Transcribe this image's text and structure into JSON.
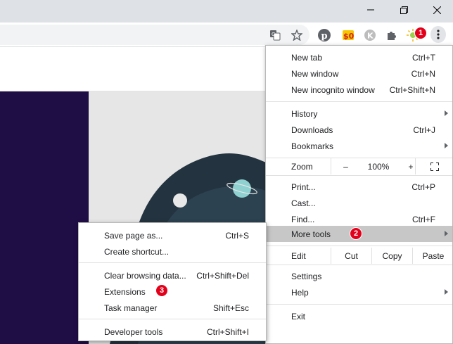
{
  "window": {
    "minimize_icon": "minimize-icon",
    "restore_icon": "restore-icon",
    "close_icon": "close-icon"
  },
  "toolbar": {
    "icons": [
      "translate-icon",
      "star-icon",
      "pinterest-icon",
      "extension-icon",
      "k-extension-icon",
      "puzzle-icon",
      "sparkle-icon",
      "kebab-menu-icon"
    ]
  },
  "chrome_menu": {
    "group1": [
      {
        "label": "New tab",
        "shortcut": "Ctrl+T"
      },
      {
        "label": "New window",
        "shortcut": "Ctrl+N"
      },
      {
        "label": "New incognito window",
        "shortcut": "Ctrl+Shift+N"
      }
    ],
    "group2": [
      {
        "label": "History",
        "shortcut": ""
      },
      {
        "label": "Downloads",
        "shortcut": "Ctrl+J"
      },
      {
        "label": "Bookmarks",
        "shortcut": ""
      }
    ],
    "zoom": {
      "label": "Zoom",
      "minus": "–",
      "value": "100%",
      "plus": "+"
    },
    "group3": [
      {
        "label": "Print...",
        "shortcut": "Ctrl+P"
      },
      {
        "label": "Cast...",
        "shortcut": ""
      },
      {
        "label": "Find...",
        "shortcut": "Ctrl+F"
      },
      {
        "label": "More tools",
        "shortcut": ""
      }
    ],
    "edit": {
      "label": "Edit",
      "cut": "Cut",
      "copy": "Copy",
      "paste": "Paste"
    },
    "group4": [
      {
        "label": "Settings",
        "shortcut": ""
      },
      {
        "label": "Help",
        "shortcut": ""
      }
    ],
    "exit": {
      "label": "Exit"
    }
  },
  "more_tools_menu": {
    "group1": [
      {
        "label": "Save page as...",
        "shortcut": "Ctrl+S"
      },
      {
        "label": "Create shortcut...",
        "shortcut": ""
      }
    ],
    "group2": [
      {
        "label": "Clear browsing data...",
        "shortcut": "Ctrl+Shift+Del"
      },
      {
        "label": "Extensions",
        "shortcut": ""
      },
      {
        "label": "Task manager",
        "shortcut": "Shift+Esc"
      }
    ],
    "group3": [
      {
        "label": "Developer tools",
        "shortcut": "Ctrl+Shift+I"
      }
    ]
  },
  "badges": {
    "one": "1",
    "two": "2",
    "three": "3"
  },
  "colors": {
    "badge": "#e3001b",
    "highlight": "#c7c7c7",
    "page_dark": "#1f0d45",
    "accent_teal": "#19a9d8"
  }
}
